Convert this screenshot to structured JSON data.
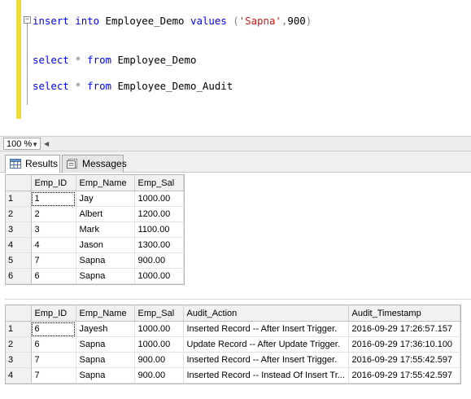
{
  "editor": {
    "collapse_glyph": "−",
    "line1": {
      "kw1": "insert",
      "kw2": "into",
      "name": " Employee_Demo ",
      "kw3": "values",
      "open": " (",
      "str": "'Sapna'",
      "comma": ",",
      "num": "900",
      "close": ")"
    },
    "line2": {
      "kw1": "select",
      "star": " * ",
      "kw2": "from",
      "name": " Employee_Demo"
    },
    "line3": {
      "kw1": "select",
      "star": " * ",
      "kw2": "from",
      "name": " Employee_Demo_Audit"
    }
  },
  "zoom": {
    "value": "100 %",
    "arrow_glyph": "▼",
    "scroll_left_glyph": "◀"
  },
  "tabs": [
    {
      "label": "Results",
      "icon": "grid-icon"
    },
    {
      "label": "Messages",
      "icon": "messages-icon"
    }
  ],
  "grid1": {
    "columns": [
      "Emp_ID",
      "Emp_Name",
      "Emp_Sal"
    ],
    "rows": [
      {
        "n": "1",
        "cells": [
          "1",
          "Jay",
          "1000.00"
        ]
      },
      {
        "n": "2",
        "cells": [
          "2",
          "Albert",
          "1200.00"
        ]
      },
      {
        "n": "3",
        "cells": [
          "3",
          "Mark",
          "1100.00"
        ]
      },
      {
        "n": "4",
        "cells": [
          "4",
          "Jason",
          "1300.00"
        ]
      },
      {
        "n": "5",
        "cells": [
          "7",
          "Sapna",
          "900.00"
        ]
      },
      {
        "n": "6",
        "cells": [
          "6",
          "Sapna",
          "1000.00"
        ]
      }
    ]
  },
  "grid2": {
    "columns": [
      "Emp_ID",
      "Emp_Name",
      "Emp_Sal",
      "Audit_Action",
      "Audit_Timestamp"
    ],
    "rows": [
      {
        "n": "1",
        "cells": [
          "6",
          "Jayesh",
          "1000.00",
          "Inserted Record -- After Insert Trigger.",
          "2016-09-29 17:26:57.157"
        ]
      },
      {
        "n": "2",
        "cells": [
          "6",
          "Sapna",
          "1000.00",
          "Update Record -- After Update Trigger.",
          "2016-09-29 17:36:10.100"
        ]
      },
      {
        "n": "3",
        "cells": [
          "7",
          "Sapna",
          "900.00",
          "Inserted Record -- After Insert Trigger.",
          "2016-09-29 17:55:42.597"
        ]
      },
      {
        "n": "4",
        "cells": [
          "7",
          "Sapna",
          "900.00",
          "Inserted Record -- Instead Of Insert Tr...",
          "2016-09-29 17:55:42.597"
        ]
      }
    ]
  }
}
